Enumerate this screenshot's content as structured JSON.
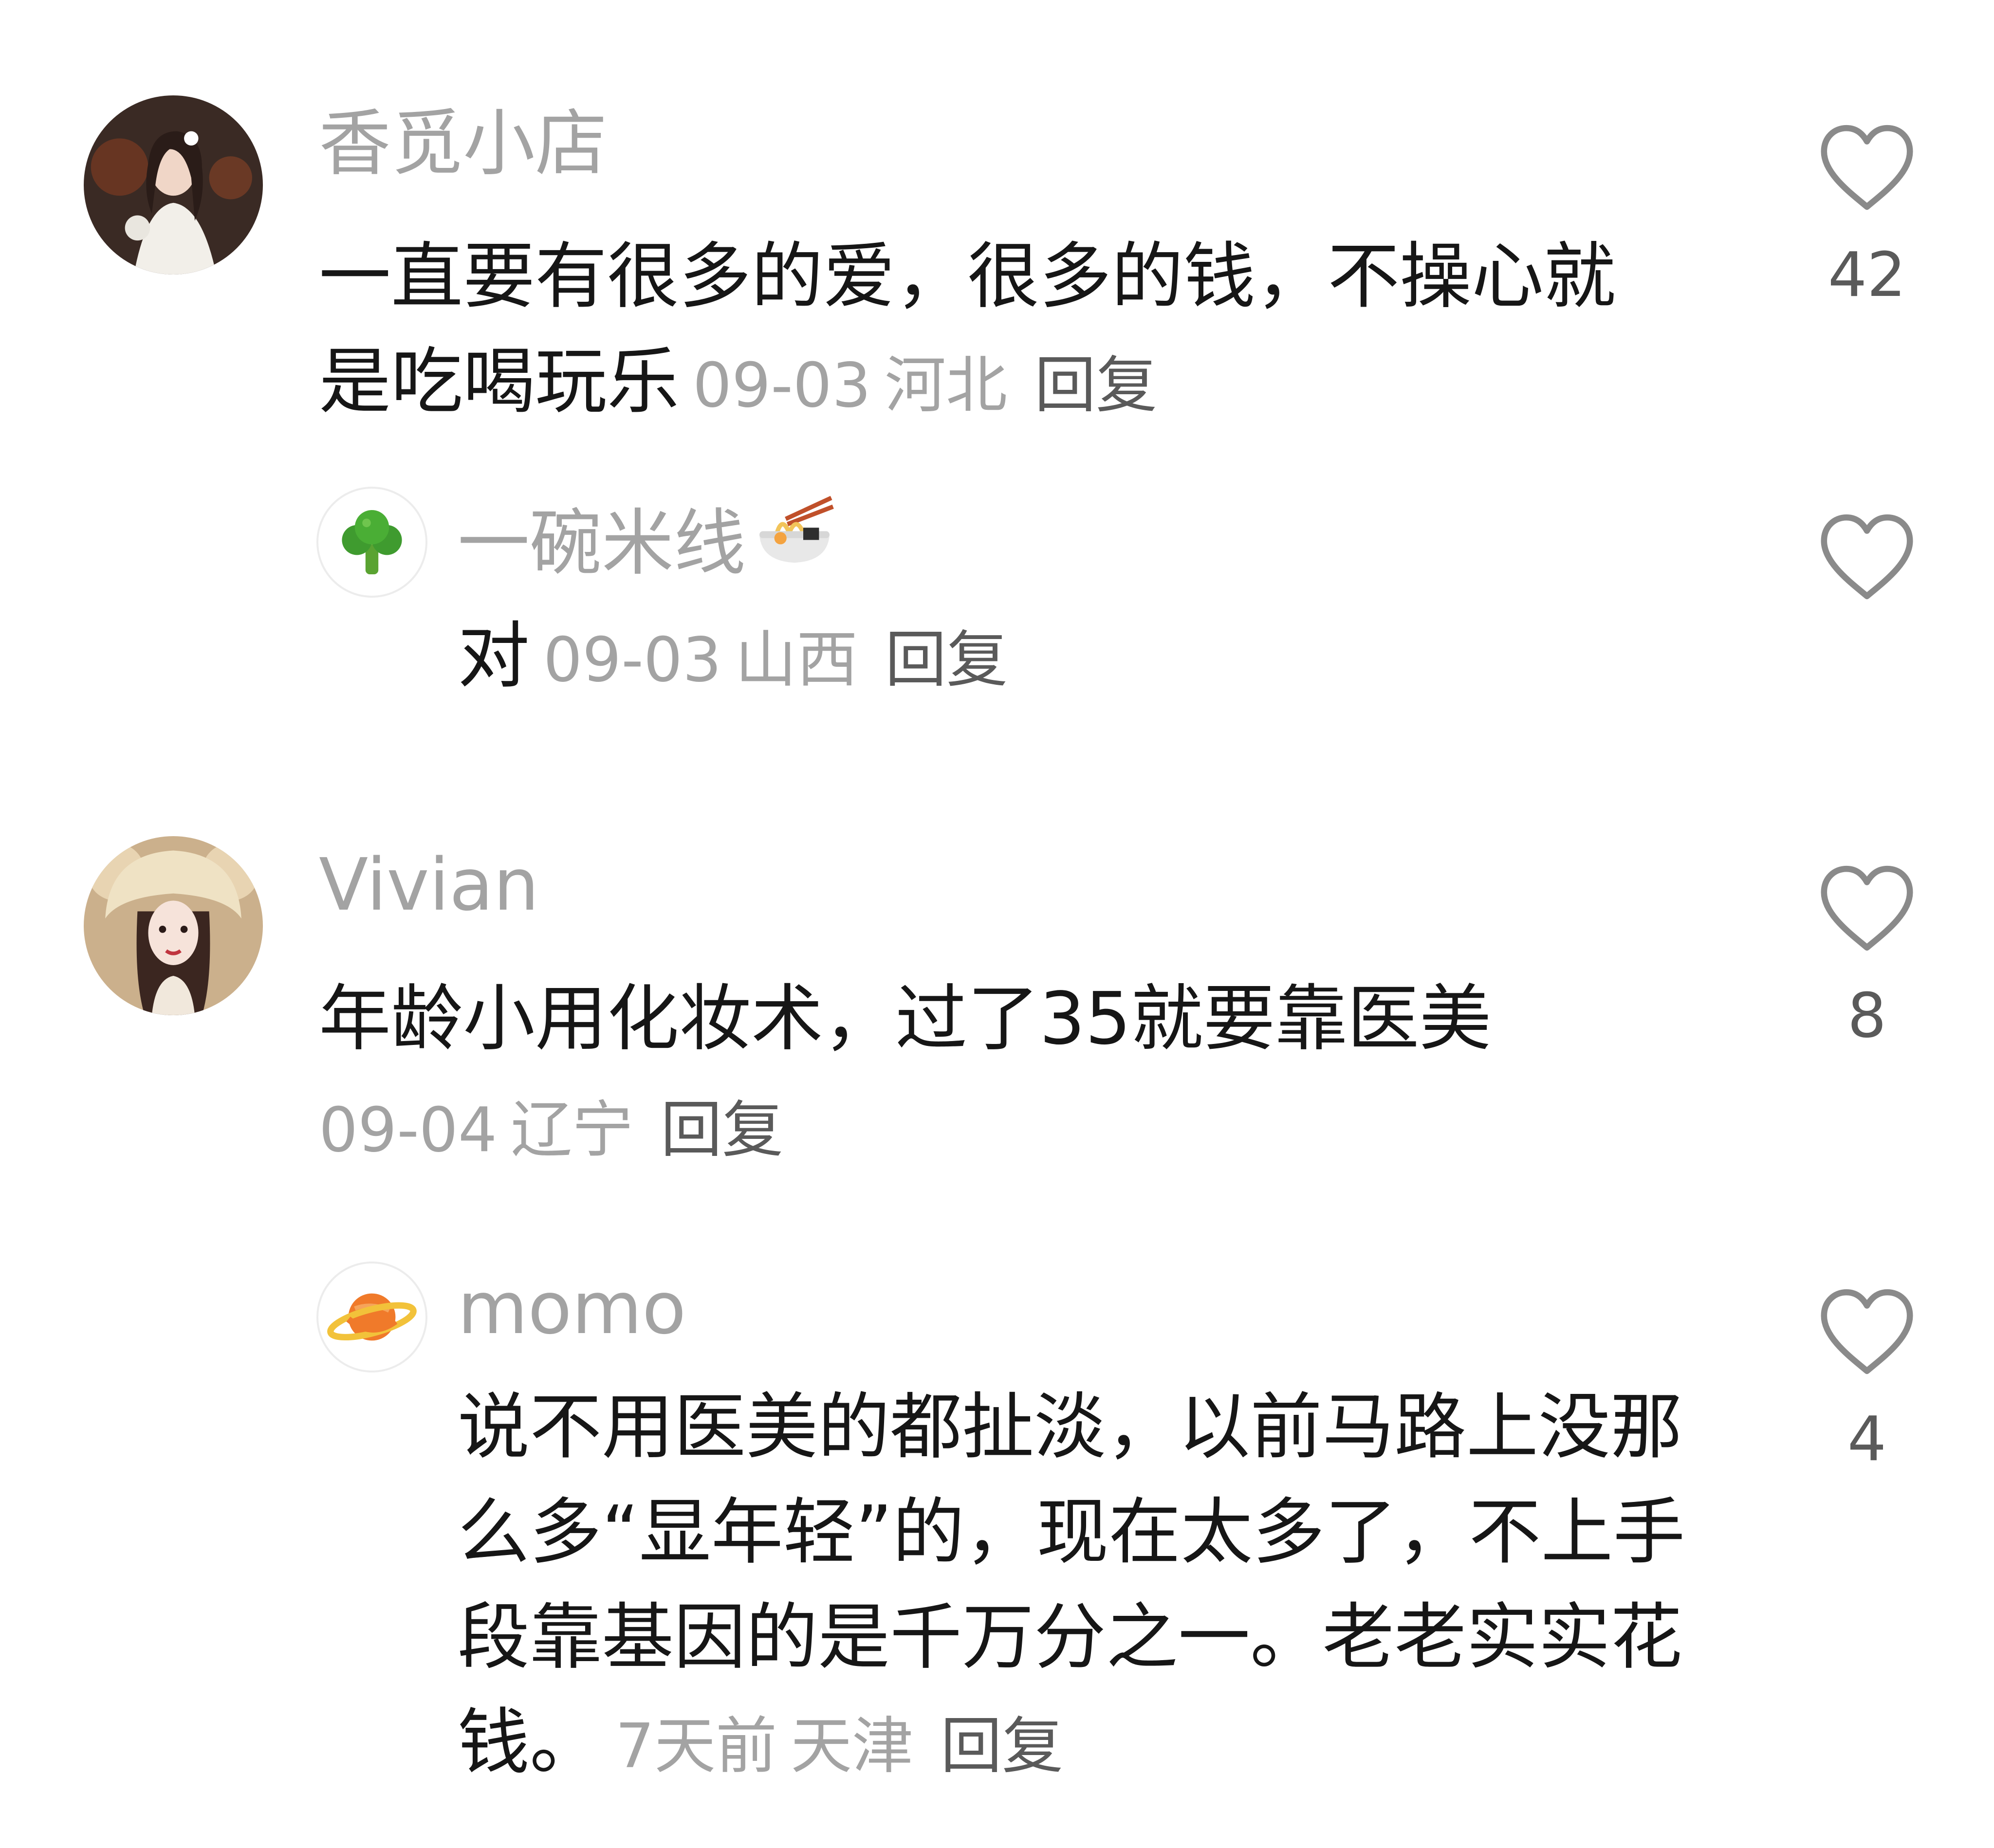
{
  "comments": [
    {
      "username": "香觅小店",
      "text": "一直要有很多的爱，很多的钱，不操心就是吃喝玩乐",
      "date": "09-03",
      "location": "河北",
      "reply_label": "回复",
      "likes": "42",
      "avatar_icon": "bride-photo-avatar",
      "replies": [
        {
          "username": "一碗米线",
          "username_emoji": "noodle-bowl-emoji",
          "text": "对",
          "date": "09-03",
          "location": "山西",
          "reply_label": "回复",
          "avatar_icon": "broccoli-avatar"
        }
      ]
    },
    {
      "username": "Vivian",
      "text": "年龄小用化妆术，过了35就要靠医美",
      "date": "09-04",
      "location": "辽宁",
      "reply_label": "回复",
      "likes": "8",
      "avatar_icon": "girl-bear-hat-avatar",
      "replies": [
        {
          "username": "momo",
          "text": "说不用医美的都扯淡，以前马路上没那么多“显年轻”的，现在太多了，不上手段靠基因的是千万分之一。老老实实花钱。",
          "date": "7天前",
          "location": "天津",
          "reply_label": "回复",
          "likes": "4",
          "avatar_icon": "planet-avatar"
        }
      ]
    }
  ],
  "colors": {
    "text_primary": "#161616",
    "text_muted": "#a3a3a3",
    "reply_link": "#5a5a5a",
    "heart_outline": "#8a8a8a"
  }
}
